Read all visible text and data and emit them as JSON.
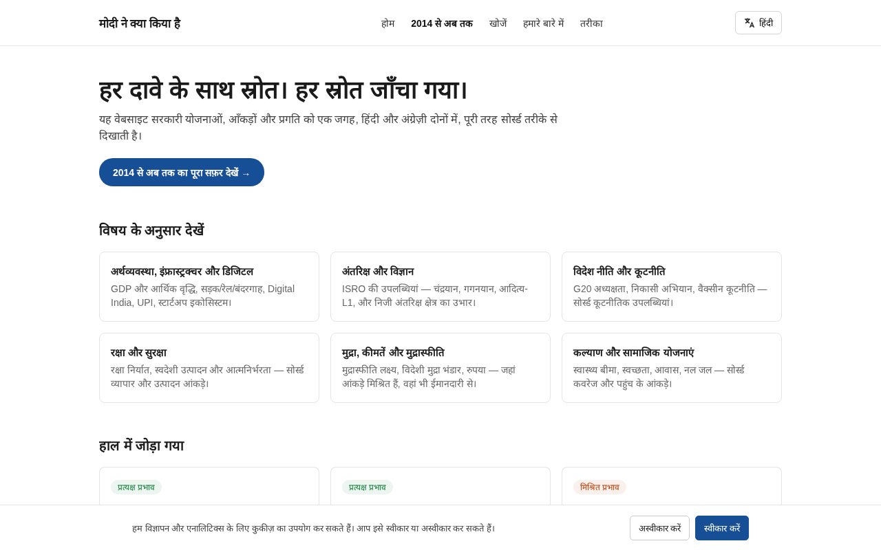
{
  "header": {
    "logo": "मोदी ने क्या किया है",
    "nav": [
      {
        "label": "होम",
        "selected": false
      },
      {
        "label": "2014 से अब तक",
        "selected": true
      },
      {
        "label": "खोजें",
        "selected": false
      },
      {
        "label": "हमारे बारे में",
        "selected": false
      },
      {
        "label": "तरीका",
        "selected": false
      }
    ],
    "language_button": "हिंदी"
  },
  "hero": {
    "title": "हर दावे के साथ स्रोत। हर स्रोत जाँचा गया।",
    "subtitle": "यह वेबसाइट सरकारी योजनाओं, आँकड़ों और प्रगति को एक जगह, हिंदी और अंग्रेज़ी दोनों में, पूरी तरह सोर्स्ड तरीके से दिखाती है।",
    "cta": "2014 से अब तक का पूरा सफ़र देखें →"
  },
  "topics": {
    "heading": "विषय के अनुसार देखें",
    "cards": [
      {
        "title": "अर्थव्यवस्था, इंफ्रास्ट्रक्चर और डिजिटल",
        "description": "GDP और आर्थिक वृद्धि, सड़क/रेल/बंदरगाह, Digital India, UPI, स्टार्टअप इकोसिस्टम।"
      },
      {
        "title": "अंतरिक्ष और विज्ञान",
        "description": "ISRO की उपलब्धियां — चंद्रयान, गगनयान, आदित्य-L1, और निजी अंतरिक्ष क्षेत्र का उभार।"
      },
      {
        "title": "विदेश नीति और कूटनीति",
        "description": "G20 अध्यक्षता, निकासी अभियान, वैक्सीन कूटनीति — सोर्स्ड कूटनीतिक उपलब्धियां।"
      },
      {
        "title": "रक्षा और सुरक्षा",
        "description": "रक्षा निर्यात, स्वदेशी उत्पादन और आत्मनिर्भरता — सोर्स्ड व्यापार और उत्पादन आंकड़े।"
      },
      {
        "title": "मुद्रा, कीमतें और मुद्रास्फीति",
        "description": "मुद्रास्फीति लक्ष्य, विदेशी मुद्रा भंडार, रुपया — जहां आंकड़े मिश्रित हैं, वहां भी ईमानदारी से।"
      },
      {
        "title": "कल्याण और सामाजिक योजनाएं",
        "description": "स्वास्थ्य बीमा, स्वच्छता, आवास, नल जल — सोर्स्ड कवरेज और पहुंच के आंकड़े।"
      }
    ]
  },
  "recent": {
    "heading": "हाल में जोड़ा गया",
    "cards": [
      {
        "tag": "प्रत्यक्ष प्रभाव",
        "color": "#15803d"
      },
      {
        "tag": "प्रत्यक्ष प्रभाव",
        "color": "#15803d"
      },
      {
        "tag": "मिश्रित प्रभाव",
        "color": "#c2410c"
      }
    ]
  },
  "cookie_bar": {
    "message": "हम विज्ञापन और एनालिटिक्स के लिए कुकीज़ का उपयोग कर सकते हैं। आप इसे स्वीकार या अस्वीकार कर सकते हैं।",
    "buttons": [
      {
        "label": "अस्वीकार करें",
        "kind": "secondary"
      },
      {
        "label": "स्वीकार करें",
        "kind": "primary"
      }
    ]
  }
}
